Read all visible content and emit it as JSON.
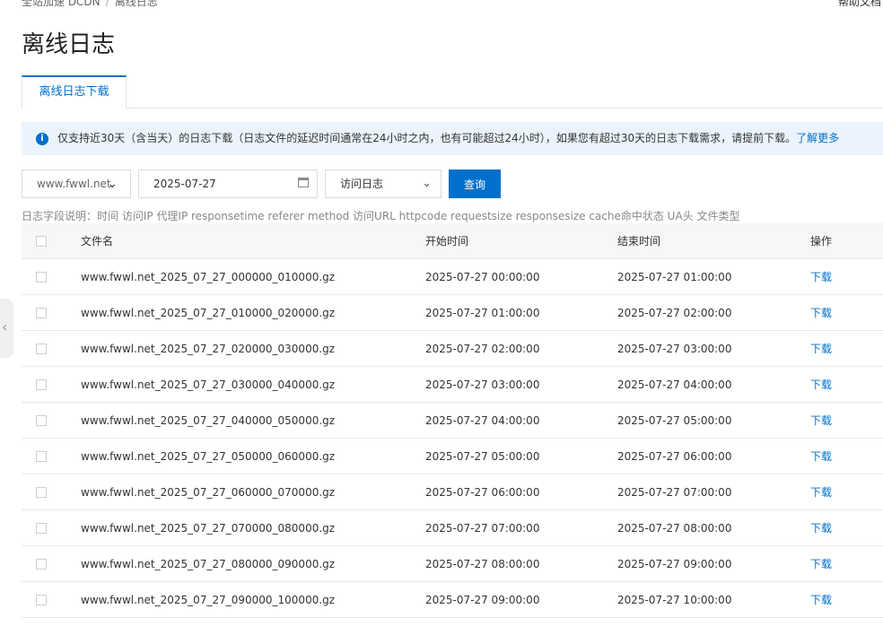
{
  "breadcrumb": {
    "root": "全站加速 DCDN",
    "separator": "/",
    "current": "离线日志"
  },
  "help_link": "帮助文档",
  "page_title": "离线日志",
  "tabs": [
    {
      "label": "离线日志下载",
      "active": true
    }
  ],
  "notice": {
    "icon": "info-icon",
    "text": "仅支持近30天（含当天）的日志下载（日志文件的延迟时间通常在24小时之内，也有可能超过24小时），如果您有超过30天的日志下载需求，请提前下载。",
    "link": "了解更多"
  },
  "filters": {
    "domain": "www.fwwl.net",
    "date": "2025-07-27",
    "log_type": "访问日志",
    "query_label": "查询"
  },
  "field_description": "日志字段说明：时间 访问IP 代理IP responsetime referer method 访问URL httpcode requestsize responsesize cache命中状态 UA头 文件类型",
  "table": {
    "columns": [
      "文件名",
      "开始时间",
      "结束时间",
      "操作"
    ],
    "rows": [
      {
        "file": "www.fwwl.net_2025_07_27_000000_010000.gz",
        "start": "2025-07-27 00:00:00",
        "end": "2025-07-27 01:00:00",
        "action": "下载"
      },
      {
        "file": "www.fwwl.net_2025_07_27_010000_020000.gz",
        "start": "2025-07-27 01:00:00",
        "end": "2025-07-27 02:00:00",
        "action": "下载"
      },
      {
        "file": "www.fwwl.net_2025_07_27_020000_030000.gz",
        "start": "2025-07-27 02:00:00",
        "end": "2025-07-27 03:00:00",
        "action": "下载"
      },
      {
        "file": "www.fwwl.net_2025_07_27_030000_040000.gz",
        "start": "2025-07-27 03:00:00",
        "end": "2025-07-27 04:00:00",
        "action": "下载"
      },
      {
        "file": "www.fwwl.net_2025_07_27_040000_050000.gz",
        "start": "2025-07-27 04:00:00",
        "end": "2025-07-27 05:00:00",
        "action": "下载"
      },
      {
        "file": "www.fwwl.net_2025_07_27_050000_060000.gz",
        "start": "2025-07-27 05:00:00",
        "end": "2025-07-27 06:00:00",
        "action": "下载"
      },
      {
        "file": "www.fwwl.net_2025_07_27_060000_070000.gz",
        "start": "2025-07-27 06:00:00",
        "end": "2025-07-27 07:00:00",
        "action": "下载"
      },
      {
        "file": "www.fwwl.net_2025_07_27_070000_080000.gz",
        "start": "2025-07-27 07:00:00",
        "end": "2025-07-27 08:00:00",
        "action": "下载"
      },
      {
        "file": "www.fwwl.net_2025_07_27_080000_090000.gz",
        "start": "2025-07-27 08:00:00",
        "end": "2025-07-27 09:00:00",
        "action": "下载"
      },
      {
        "file": "www.fwwl.net_2025_07_27_090000_100000.gz",
        "start": "2025-07-27 09:00:00",
        "end": "2025-07-27 10:00:00",
        "action": "下载"
      }
    ]
  },
  "colors": {
    "accent": "#0070cc",
    "notice_bg": "#ebf4fd"
  }
}
